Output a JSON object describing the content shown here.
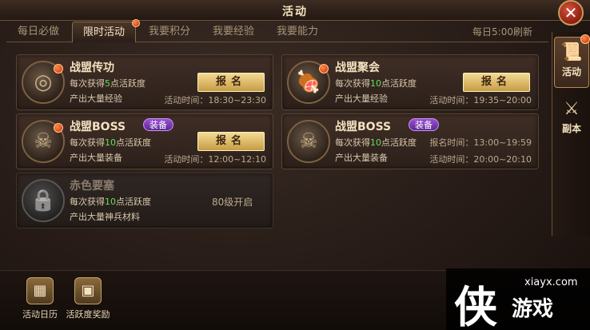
{
  "window": {
    "title": "活动",
    "close_icon": "close-icon"
  },
  "tabs": [
    {
      "label": "每日必做",
      "active": false,
      "dot": false
    },
    {
      "label": "限时活动",
      "active": true,
      "dot": true
    },
    {
      "label": "我要积分",
      "active": false,
      "dot": false
    },
    {
      "label": "我要经验",
      "active": false,
      "dot": false
    },
    {
      "label": "我要能力",
      "active": false,
      "dot": false
    }
  ],
  "refresh_text": "每日5:00刷新",
  "cards": [
    {
      "title": "战盟传功",
      "icon": "swirl-emblem-icon",
      "line1_prefix": "每次获得",
      "line1_num": "5",
      "line1_suffix": "点活跃度",
      "line2": "产出大量经验",
      "button": "报名",
      "times": [
        "活动时间：18:30~23:30"
      ],
      "dot": true
    },
    {
      "title": "战盟聚会",
      "icon": "roast-meat-icon",
      "line1_prefix": "每次获得",
      "line1_num": "10",
      "line1_suffix": "点活跃度",
      "line2": "产出大量经验",
      "button": "报名",
      "times": [
        "活动时间：19:35~20:00"
      ],
      "dot": true
    },
    {
      "title": "战盟BOSS",
      "badge": "装备",
      "icon": "demon-skull-icon",
      "line1_prefix": "每次获得",
      "line1_num": "10",
      "line1_suffix": "点活跃度",
      "line2": "产出大量装备",
      "button": "报名",
      "times": [
        "活动时间：12:00~12:10"
      ],
      "dot": true
    },
    {
      "title": "战盟BOSS",
      "badge": "装备",
      "icon": "demon-skull-icon",
      "line1_prefix": "每次获得",
      "line1_num": "10",
      "line1_suffix": "点活跃度",
      "line2": "产出大量装备",
      "times": [
        "报名时间：13:00~19:59",
        "活动时间：20:00~20:10"
      ],
      "dot": false
    },
    {
      "title": "赤色要塞",
      "icon": "padlock-icon",
      "line1_prefix": "每次获得",
      "line1_num": "10",
      "line1_suffix": "点活跃度",
      "line2": "产出大量神兵材料",
      "unlock": "80级开启",
      "disabled": true,
      "dot": false
    }
  ],
  "side_tabs": [
    {
      "label": "活动",
      "icon": "scroll-icon",
      "active": true,
      "dot": true
    },
    {
      "label": "副本",
      "icon": "crossed-swords-icon",
      "active": false,
      "dot": false
    }
  ],
  "bottom_buttons": [
    {
      "label": "活动日历",
      "icon": "calendar-icon"
    },
    {
      "label": "活跃度奖励",
      "icon": "treasure-chest-icon"
    }
  ],
  "watermark": {
    "char": "侠",
    "site": "xiayx.com",
    "name": "游戏"
  },
  "colors": {
    "accent_gold": "#c69c45",
    "highlight_green": "#5ee35b",
    "badge_purple": "#7a3ab8",
    "notify_red": "#d12a0c"
  }
}
